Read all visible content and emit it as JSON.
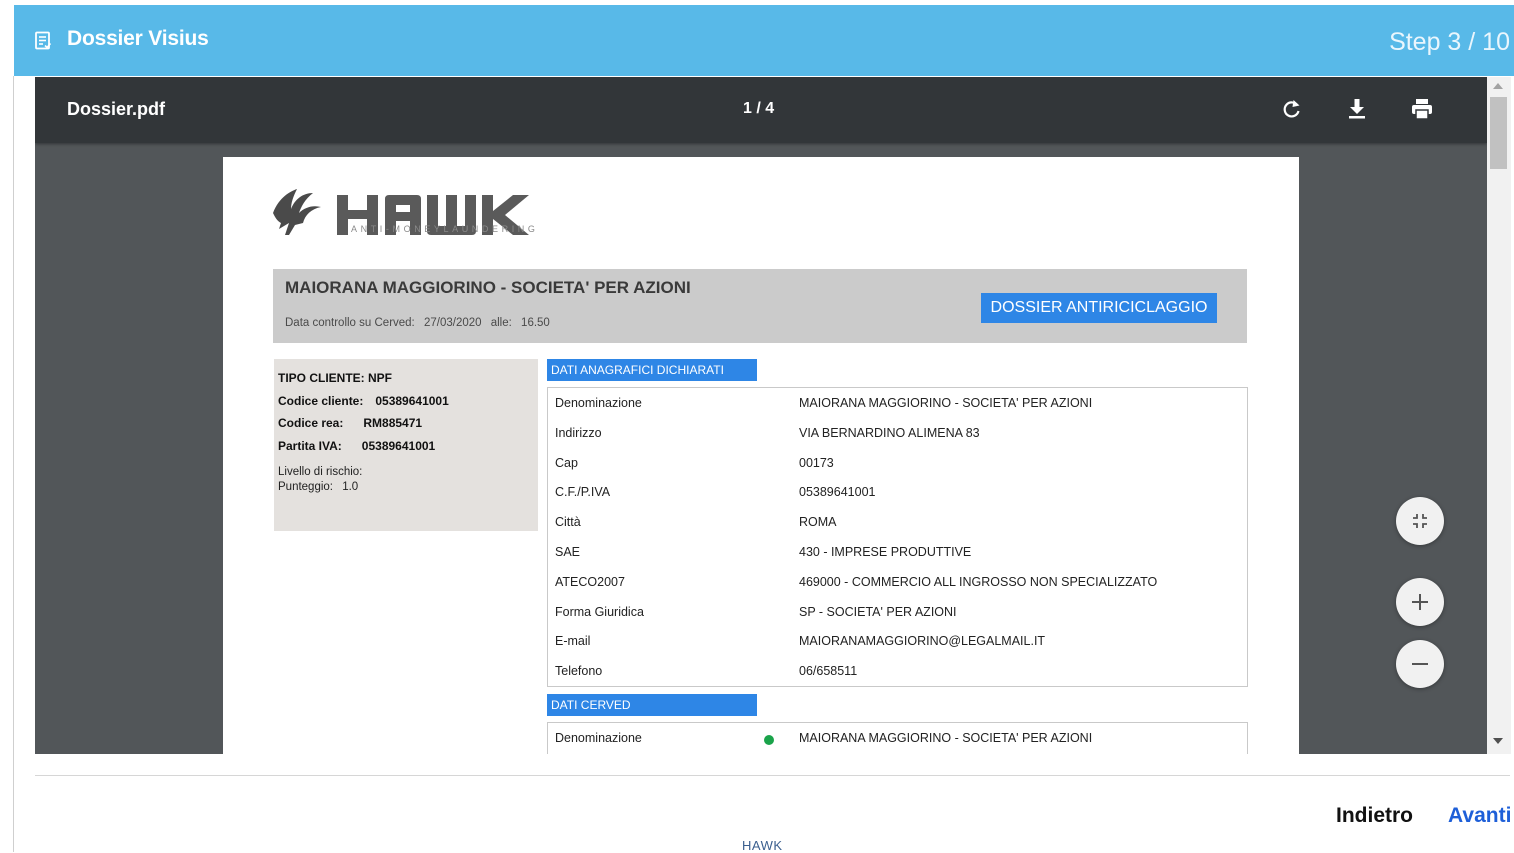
{
  "header": {
    "title": "Dossier Visius",
    "step": "Step 3 / 10",
    "icon": "document-list-icon"
  },
  "viewer": {
    "file_name": "Dossier.pdf",
    "page_counter": "1 / 4",
    "toolbar_icons": [
      "rotate-icon",
      "download-icon",
      "print-icon"
    ],
    "zoom_icons": [
      "fit-page-icon",
      "zoom-in-icon",
      "zoom-out-icon"
    ]
  },
  "document": {
    "logo_text": "HAWK",
    "logo_tagline": "ANTI-MONEYLAUNDERING",
    "company_name": "MAIORANA MAGGIORINO - SOCIETA' PER AZIONI",
    "check_label": "Data controllo su Cerved:",
    "check_date": "27/03/2020",
    "check_at_label": "alle:",
    "check_time": "16.50",
    "badge": "DOSSIER ANTIRICICLAGGIO",
    "client": {
      "type": "TIPO CLIENTE: NPF",
      "code_label": "Codice cliente:",
      "code_value": "05389641001",
      "rea_label": "Codice rea:",
      "rea_value": "RM885471",
      "vat_label": "Partita IVA:",
      "vat_value": "05389641001",
      "risk_label": "Livello di rischio:",
      "score_label": "Punteggio:",
      "score_value": "1.0"
    },
    "section_anagrafici": {
      "title": "DATI ANAGRAFICI DICHIARATI",
      "rows": [
        {
          "label": "Denominazione",
          "value": "MAIORANA MAGGIORINO - SOCIETA' PER AZIONI"
        },
        {
          "label": "Indirizzo",
          "value": "VIA BERNARDINO ALIMENA 83"
        },
        {
          "label": "Cap",
          "value": "00173"
        },
        {
          "label": "C.F./P.IVA",
          "value": "05389641001"
        },
        {
          "label": "Città",
          "value": "ROMA"
        },
        {
          "label": "SAE",
          "value": "430 - IMPRESE PRODUTTIVE"
        },
        {
          "label": "ATECO2007",
          "value": "469000 - COMMERCIO ALL INGROSSO NON SPECIALIZZATO"
        },
        {
          "label": "Forma Giuridica",
          "value": "SP - SOCIETA' PER AZIONI"
        },
        {
          "label": "E-mail",
          "value": "MAIORANAMAGGIORINO@LEGALMAIL.IT"
        },
        {
          "label": "Telefono",
          "value": "06/658511"
        }
      ]
    },
    "section_cerved": {
      "title": "DATI CERVED",
      "rows": [
        {
          "label": "Denominazione",
          "value": "MAIORANA MAGGIORINO - SOCIETA' PER AZIONI",
          "status_color": "#1aa34a"
        }
      ]
    }
  },
  "footer": {
    "back_label": "Indietro",
    "next_label": "Avanti",
    "brand": "HAWK"
  },
  "colors": {
    "header_bg": "#58b9e8",
    "accent_blue": "#2e86e6",
    "next_link": "#1e5fd8",
    "viewer_bg": "#525659",
    "toolbar_bg": "#323639"
  }
}
